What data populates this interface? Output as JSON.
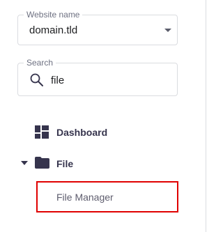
{
  "website_select": {
    "label": "Website name",
    "value": "domain.tld"
  },
  "search": {
    "label": "Search",
    "value": "file"
  },
  "nav": {
    "dashboard": {
      "label": "Dashboard",
      "icon": "dashboard-icon"
    },
    "file": {
      "label": "File",
      "icon": "folder-icon",
      "expanded": true,
      "children": [
        {
          "label": "File Manager",
          "highlighted": true,
          "highlight_color": "#e00000"
        }
      ]
    }
  }
}
